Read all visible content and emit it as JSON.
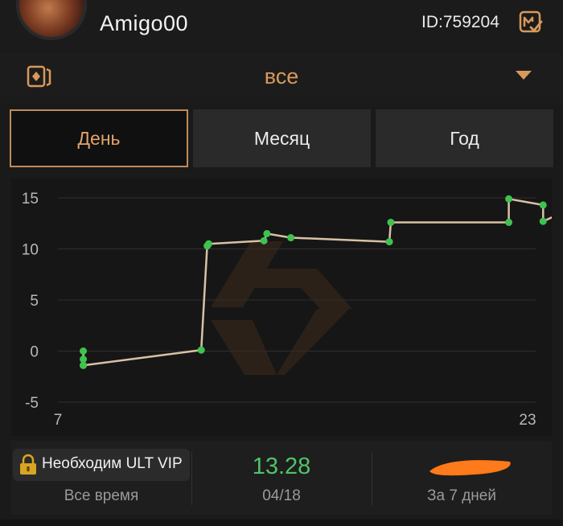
{
  "header": {
    "username": "Amigo00",
    "user_id": "ID:759204",
    "avatar_icon": "avatar",
    "badge_icon": "verified-m-icon",
    "accent_color": "#d9985b"
  },
  "filter": {
    "icon": "card-icon",
    "value": "все",
    "dropdown_icon": "triangle-down-icon"
  },
  "tabs": [
    {
      "label": "День",
      "active": true
    },
    {
      "label": "Месяц",
      "active": false
    },
    {
      "label": "Год",
      "active": false
    }
  ],
  "chart_data": {
    "type": "line",
    "ylim": [
      -5,
      15
    ],
    "y_ticks": [
      "15",
      "10",
      "5",
      "0",
      "-5"
    ],
    "x_ticks": [
      "7",
      "23"
    ],
    "xlim": [
      7,
      23
    ],
    "grid": true,
    "line_color": "#d8c2a3",
    "marker_color": "#3fc24f",
    "series": [
      {
        "x": [
          7.85,
          7.85,
          7.85,
          7.85,
          11.8,
          12.0,
          12.05,
          13.9,
          14.0,
          14.8,
          18.1,
          18.15,
          22.1,
          22.1,
          23.25,
          23.25,
          23.7,
          23.75
        ],
        "values": [
          0.0,
          -0.8,
          -1.4,
          -1.4,
          0.1,
          10.3,
          10.5,
          10.8,
          11.5,
          11.1,
          10.7,
          12.6,
          12.6,
          14.9,
          14.3,
          12.7,
          13.3,
          13.3
        ]
      }
    ]
  },
  "stats": {
    "vip_lock_text": "Необходим ULT VIP",
    "lock_icon": "lock-icon",
    "all_time_label": "Все время",
    "value": "13.28",
    "date": "04/18",
    "week_label": "За 7 дней"
  }
}
